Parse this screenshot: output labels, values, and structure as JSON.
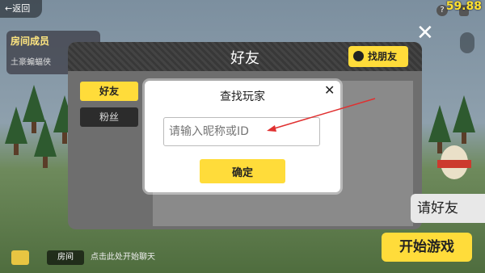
{
  "status": {
    "back_label": "返回",
    "fps": "59.88"
  },
  "members": {
    "title": "房间成员",
    "name": "土豪蝙蝠侠"
  },
  "friends_panel": {
    "title": "好友",
    "find_friend_label": "找朋友",
    "tabs": [
      {
        "label": "好友"
      },
      {
        "label": "粉丝"
      }
    ],
    "invite_label": "请好友",
    "start_label": "开始游戏"
  },
  "chat": {
    "room_label": "房间",
    "hint": "点击此处开始聊天"
  },
  "find_dialog": {
    "title": "查找玩家",
    "input_placeholder": "请输入昵称或ID",
    "input_value": "",
    "confirm_label": "确定"
  },
  "colors": {
    "accent": "#ffdc3a",
    "annotation": "#e03030"
  },
  "icons": [
    "close-icon",
    "help-icon",
    "speaker-icon",
    "microphone-icon",
    "add-friend-icon",
    "chat-icon"
  ]
}
